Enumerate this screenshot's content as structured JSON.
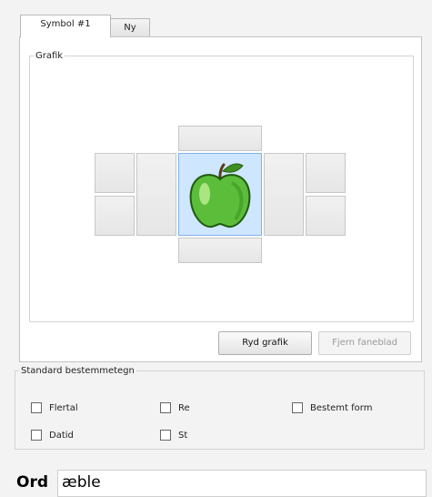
{
  "tabs": [
    {
      "label": "Symbol #1",
      "active": true
    },
    {
      "label": "Ny",
      "active": false
    }
  ],
  "graphics_group": {
    "title": "Grafik",
    "center_image": "green-apple-icon",
    "clear_button": "Ryd grafik",
    "remove_tab_button": "Fjern faneblad"
  },
  "determiners_group": {
    "title": "Standard bestemmetegn",
    "options": [
      {
        "label": "Flertal",
        "checked": false
      },
      {
        "label": "Re",
        "checked": false
      },
      {
        "label": "Bestemt form",
        "checked": false
      },
      {
        "label": "Datid",
        "checked": false
      },
      {
        "label": "St",
        "checked": false
      }
    ]
  },
  "word": {
    "label": "Ord",
    "value": "æble"
  },
  "colors": {
    "selected_cell": "#cfe6ff",
    "apple_green": "#5bbd3a"
  }
}
